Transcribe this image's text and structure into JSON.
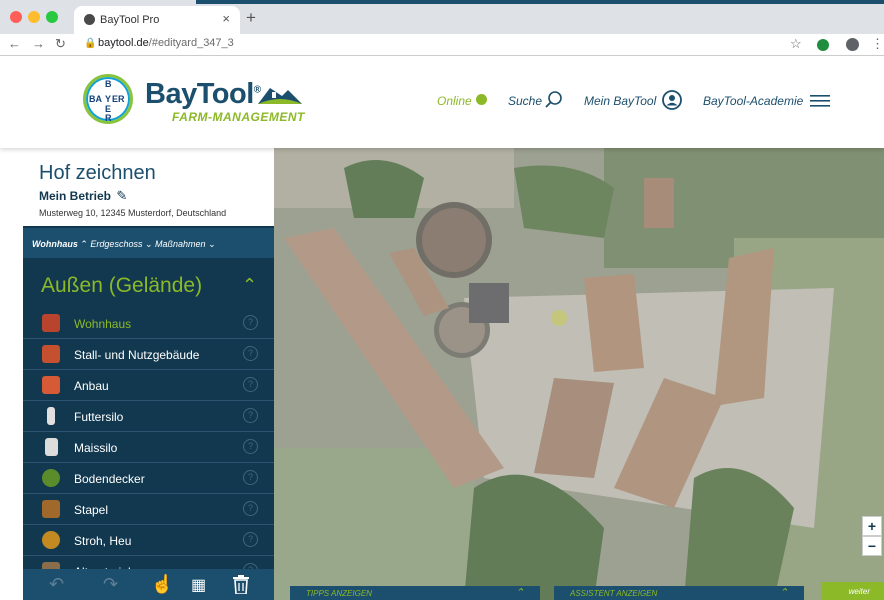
{
  "browser": {
    "tab_title": "BayTool Pro",
    "url_host": "baytool.de",
    "url_path": "/#edityard_347_3"
  },
  "header": {
    "brand": "BayTool",
    "brand_sub": "FARM-MANAGEMENT",
    "logo_letters": {
      "top": "B",
      "left": "BA",
      "center": "Y",
      "right": "ER",
      "r2": "E",
      "bottom": "R"
    },
    "nav": {
      "online": "Online",
      "search": "Suche",
      "account": "Mein BayTool",
      "academy": "BayTool-Academie"
    }
  },
  "sidebar": {
    "title": "Hof zeichnen",
    "farm": "Mein Betrieb",
    "address": "Musterweg 10, 12345 Musterdorf, Deutschland",
    "crumbs": [
      "Wohnhaus",
      "Erdgeschoss",
      "Maßnahmen"
    ],
    "section": "Außen (Gelände)",
    "items": [
      {
        "label": "Wohnhaus",
        "active": true,
        "color": "#b8442e"
      },
      {
        "label": "Stall- und Nutzgebäude",
        "active": false,
        "color": "#c4502f"
      },
      {
        "label": "Anbau",
        "active": false,
        "color": "#d65a35"
      },
      {
        "label": "Futtersilo",
        "active": false,
        "color": "#e0e0e0"
      },
      {
        "label": "Maissilo",
        "active": false,
        "color": "#dcdcdc"
      },
      {
        "label": "Bodendecker",
        "active": false,
        "color": "#5a8c2c"
      },
      {
        "label": "Stapel",
        "active": false,
        "color": "#a0682a"
      },
      {
        "label": "Stroh, Heu",
        "active": false,
        "color": "#c48a22"
      },
      {
        "label": "Altmaterial",
        "active": false,
        "color": "#8a6e4a"
      }
    ],
    "help_glyph": "?"
  },
  "bottom": {
    "tips": "TIPPS ANZEIGEN",
    "assistant": "ASSISTENT ANZEIGEN",
    "next": "weiter"
  },
  "map": {
    "zoom_in": "+",
    "zoom_out": "−"
  },
  "colors": {
    "brand_blue": "#1c4f6d",
    "brand_green": "#8cb927",
    "sidebar_bg": "#11384f",
    "online_dot": "#8cb927"
  }
}
